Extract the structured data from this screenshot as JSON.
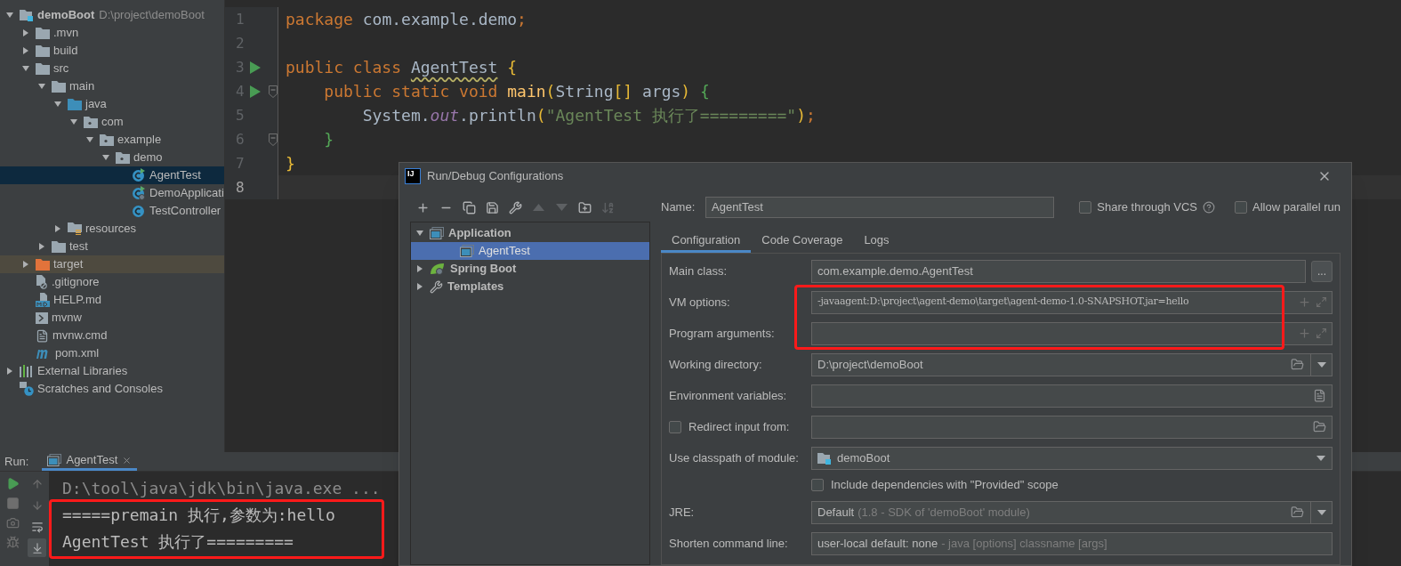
{
  "project_tree": [
    {
      "name": "demoBoot",
      "path": "D:\\project\\demoBoot",
      "kind": "module",
      "expanded": true,
      "selected": false,
      "children": [
        {
          "name": ".mvn",
          "kind": "folder",
          "expanded": false,
          "selected": false
        },
        {
          "name": "build",
          "kind": "folder",
          "expanded": false,
          "selected": false
        },
        {
          "name": "src",
          "kind": "folder",
          "expanded": true,
          "selected": false,
          "children": [
            {
              "name": "main",
              "kind": "folder",
              "expanded": true,
              "selected": false,
              "children": [
                {
                  "name": "java",
                  "kind": "source-folder",
                  "expanded": true,
                  "selected": false,
                  "children": [
                    {
                      "name": "com",
                      "kind": "package",
                      "expanded": true,
                      "selected": false,
                      "children": [
                        {
                          "name": "example",
                          "kind": "package",
                          "expanded": true,
                          "selected": false,
                          "children": [
                            {
                              "name": "demo",
                              "kind": "package",
                              "expanded": true,
                              "selected": false,
                              "children": [
                                {
                                  "name": "AgentTest",
                                  "kind": "runnable-class",
                                  "selected": true
                                },
                                {
                                  "name": "DemoApplicati",
                                  "kind": "spring-class",
                                  "selected": false
                                },
                                {
                                  "name": "TestController",
                                  "kind": "class",
                                  "selected": false
                                }
                              ]
                            }
                          ]
                        }
                      ]
                    }
                  ]
                },
                {
                  "name": "resources",
                  "kind": "resources-folder",
                  "expanded": false,
                  "selected": false
                }
              ]
            },
            {
              "name": "test",
              "kind": "folder",
              "expanded": false,
              "selected": false
            }
          ]
        },
        {
          "name": "target",
          "kind": "excluded-folder",
          "expanded": false,
          "selected": false
        },
        {
          "name": ".gitignore",
          "kind": "ignore-file",
          "selected": false
        },
        {
          "name": "HELP.md",
          "kind": "markdown-file",
          "selected": false
        },
        {
          "name": "mvnw",
          "kind": "script-file",
          "selected": false
        },
        {
          "name": "mvnw.cmd",
          "kind": "text-file",
          "selected": false
        },
        {
          "name": "pom.xml",
          "kind": "maven-file",
          "selected": false
        }
      ]
    },
    {
      "name": "External Libraries",
      "kind": "libraries",
      "expanded": false,
      "selected": false
    },
    {
      "name": "Scratches and Consoles",
      "kind": "scratches",
      "selected": false
    }
  ],
  "editor": {
    "lines": [
      {
        "number": "1",
        "run_marker": false,
        "fold_marker": false,
        "current": false,
        "tokens": [
          {
            "kind": "keyword",
            "text": "package "
          },
          {
            "kind": "plain",
            "text": "com.example.demo"
          },
          {
            "kind": "keyword",
            "text": ";"
          }
        ]
      },
      {
        "number": "2",
        "run_marker": false,
        "fold_marker": false,
        "current": false
      },
      {
        "number": "3",
        "run_marker": true,
        "fold_marker": false,
        "current": false,
        "tokens": [
          {
            "kind": "keyword",
            "text": "public class "
          },
          {
            "kind": "warning",
            "text": "AgentTest"
          },
          {
            "kind": "bracket-yellow",
            "text": " {"
          }
        ]
      },
      {
        "number": "4",
        "run_marker": true,
        "fold_marker": true,
        "current": false,
        "tokens": [
          {
            "kind": "keyword",
            "text": "    public static void "
          },
          {
            "kind": "method",
            "text": "main"
          },
          {
            "kind": "bracket-yellow",
            "text": "("
          },
          {
            "kind": "plain",
            "text": "String"
          },
          {
            "kind": "bracket-yellow",
            "text": "[]"
          },
          {
            "kind": "plain",
            "text": " args"
          },
          {
            "kind": "bracket-yellow",
            "text": ")"
          },
          {
            "kind": "bracket-green",
            "text": " {"
          }
        ]
      },
      {
        "number": "5",
        "run_marker": false,
        "fold_marker": false,
        "current": false,
        "tokens": [
          {
            "kind": "plain",
            "text": "        System."
          },
          {
            "kind": "static-field",
            "text": "out"
          },
          {
            "kind": "plain",
            "text": ".println"
          },
          {
            "kind": "bracket-yellow",
            "text": "("
          },
          {
            "kind": "string",
            "text": "\"AgentTest 执行了=========\""
          },
          {
            "kind": "bracket-yellow",
            "text": ")"
          },
          {
            "kind": "keyword",
            "text": ";"
          }
        ]
      },
      {
        "number": "6",
        "run_marker": false,
        "fold_marker": true,
        "current": false,
        "tokens": [
          {
            "kind": "bracket-green",
            "text": "    }"
          }
        ]
      },
      {
        "number": "7",
        "run_marker": false,
        "fold_marker": false,
        "current": false,
        "tokens": [
          {
            "kind": "bracket-yellow",
            "text": "}"
          }
        ]
      },
      {
        "number": "8",
        "run_marker": false,
        "fold_marker": false,
        "current": true
      }
    ]
  },
  "dialog": {
    "logo": "IJ",
    "title": "Run/Debug Configurations",
    "toolbar": [
      {
        "kind": "add",
        "disabled": false
      },
      {
        "kind": "remove",
        "disabled": false
      },
      {
        "kind": "copy",
        "disabled": false
      },
      {
        "kind": "save",
        "disabled": false
      },
      {
        "kind": "edit-defaults",
        "disabled": false
      },
      {
        "kind": "move-up",
        "disabled": true
      },
      {
        "kind": "move-down",
        "disabled": true
      },
      {
        "kind": "new-folder",
        "disabled": false
      },
      {
        "kind": "sort",
        "disabled": true
      }
    ],
    "config_tree": [
      {
        "name": "Application",
        "kind": "application",
        "expanded": true,
        "selected": false,
        "children": [
          {
            "name": "AgentTest",
            "kind": "application-config",
            "selected": true
          }
        ]
      },
      {
        "name": "Spring Boot",
        "kind": "spring-boot",
        "expanded": false,
        "selected": false
      },
      {
        "name": "Templates",
        "kind": "templates",
        "expanded": false,
        "selected": false
      }
    ],
    "name_field": {
      "label": "Name:",
      "value": "AgentTest"
    },
    "options": [
      {
        "label": "Share through VCS",
        "checked": false,
        "help": true
      },
      {
        "label": "Allow parallel run",
        "checked": false,
        "help": false
      }
    ],
    "tabs": [
      {
        "label": "Configuration",
        "selected": true
      },
      {
        "label": "Code Coverage",
        "selected": false
      },
      {
        "label": "Logs",
        "selected": false
      }
    ],
    "form": [
      {
        "kind": "browse",
        "label": "Main class:",
        "value": "com.example.demo.AgentTest",
        "button": "..."
      },
      {
        "kind": "expandable",
        "label": "VM options:",
        "value": "-javaagent:D:\\project\\agent-demo\\target\\agent-demo-1.0-SNAPSHOT.jar=hello"
      },
      {
        "kind": "expandable",
        "label": "Program arguments:"
      },
      {
        "kind": "path-select",
        "label": "Working directory:",
        "value": "D:\\project\\demoBoot"
      },
      {
        "kind": "env",
        "label": "Environment variables:"
      },
      {
        "kind": "checkbox-path",
        "label": "Redirect input from:",
        "checked": false
      },
      {
        "kind": "module-select",
        "label": "Use classpath of module:",
        "value": "demoBoot"
      },
      {
        "kind": "checkbox",
        "label": "Include dependencies with \"Provided\" scope",
        "checked": false
      },
      {
        "kind": "path-select",
        "label": "JRE:",
        "value": "Default",
        "detail": "(1.8 - SDK of 'demoBoot' module)"
      },
      {
        "kind": "select",
        "label": "Shorten command line:",
        "value": "user-local default: none",
        "detail": "- java [options] classname [args]"
      }
    ]
  },
  "run_panel": {
    "label": "Run:",
    "tabs": [
      {
        "title": "AgentTest",
        "selected": true
      }
    ],
    "toolbar": [
      {
        "kind": "run",
        "disabled": false
      },
      {
        "kind": "stop",
        "disabled": true
      },
      {
        "kind": "camera",
        "disabled": true
      },
      {
        "kind": "debug",
        "disabled": true
      }
    ],
    "console_toolbar": [
      {
        "kind": "up",
        "selected": false
      },
      {
        "kind": "down",
        "selected": false
      },
      {
        "kind": "wrap",
        "selected": false
      },
      {
        "kind": "scroll-end",
        "selected": true
      }
    ],
    "console": [
      {
        "kind": "command",
        "text": "D:\\tool\\java\\jdk\\bin\\java.exe ..."
      },
      {
        "kind": "output",
        "text": "=====premain 执行,参数为:hello"
      },
      {
        "kind": "output",
        "text": "AgentTest 执行了========="
      }
    ]
  }
}
